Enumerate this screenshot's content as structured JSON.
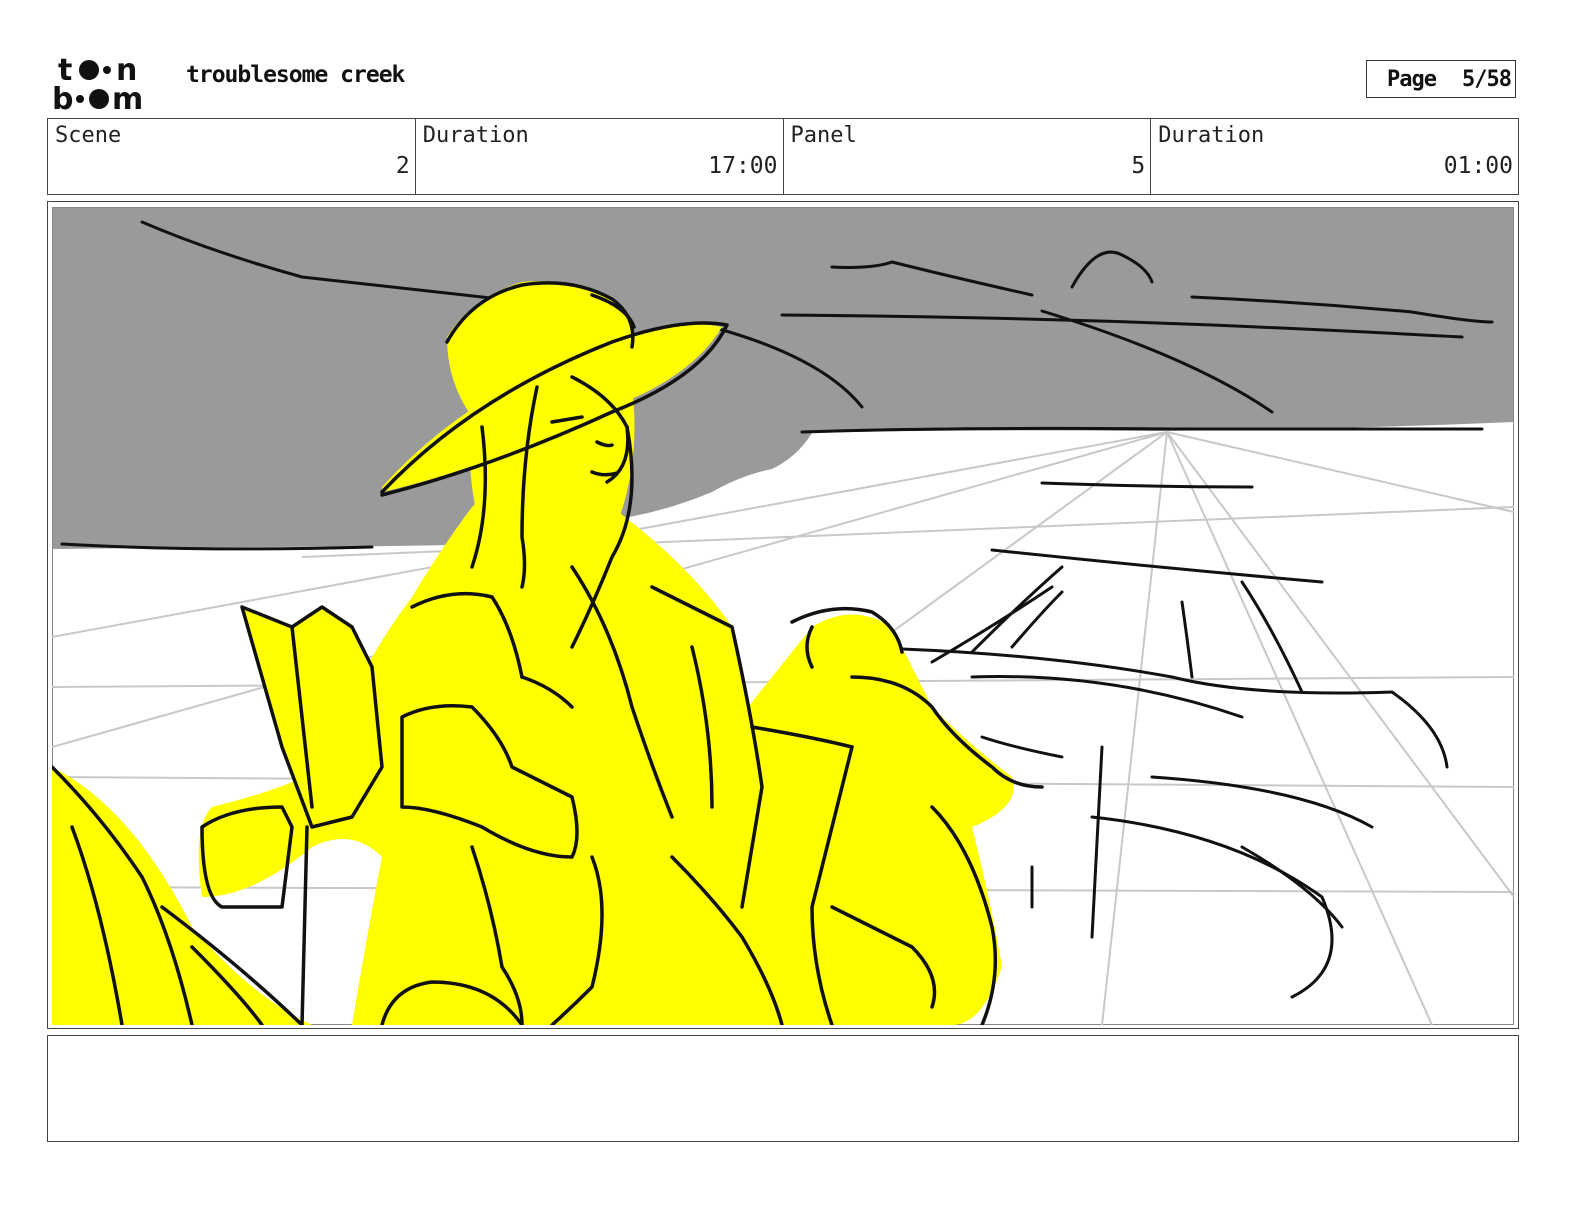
{
  "header": {
    "project_title": "troublesome creek",
    "page_label": "Page",
    "page_value": "5/58"
  },
  "info": {
    "scene_label": "Scene",
    "scene_value": "2",
    "duration_label": "Duration",
    "duration_value": "17:00",
    "panel_label": "Panel",
    "panel_value": "5",
    "panel_duration_label": "Duration",
    "panel_duration_value": "01:00"
  },
  "colors": {
    "sky": "#9a9a9a",
    "highlight": "#ffff00",
    "ink": "#111111",
    "guide": "#c8c8c8"
  },
  "notes": {
    "text": ""
  }
}
